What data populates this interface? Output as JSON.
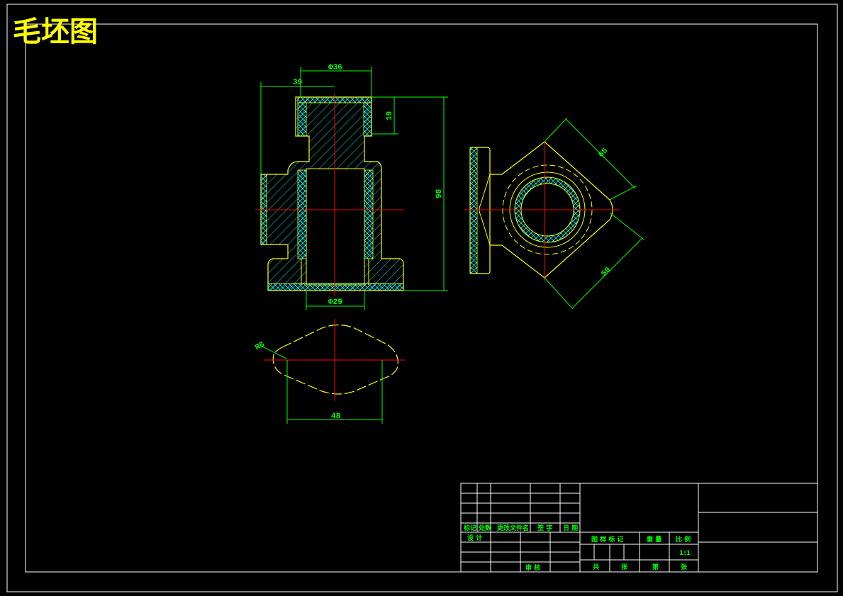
{
  "drawing": {
    "title": "毛坯图",
    "colors": {
      "background": "#000000",
      "border": "#ffffff",
      "outline": "#ffff00",
      "dimension": "#00ff00",
      "centerline": "#ff0000",
      "hatch": "#00ffff"
    }
  },
  "dimensions": {
    "d36": "Φ36",
    "d39": "39",
    "d19": "19",
    "d98": "98",
    "d29": "Φ29",
    "d65": "65",
    "d50": "50",
    "r8": "R8",
    "d48": "48"
  },
  "title_block": {
    "mark": "标记",
    "count": "处数",
    "change_doc": "更改文件名",
    "signature": "签 字",
    "date": "日 期",
    "design": "设 计",
    "review": "审 核",
    "stage_mark": "图 样 标 记",
    "weight": "重 量",
    "scale_label": "比 例",
    "scale_value": "1:1",
    "total": "共",
    "sheets": "张",
    "sheet_no": "第",
    "page": "张"
  }
}
